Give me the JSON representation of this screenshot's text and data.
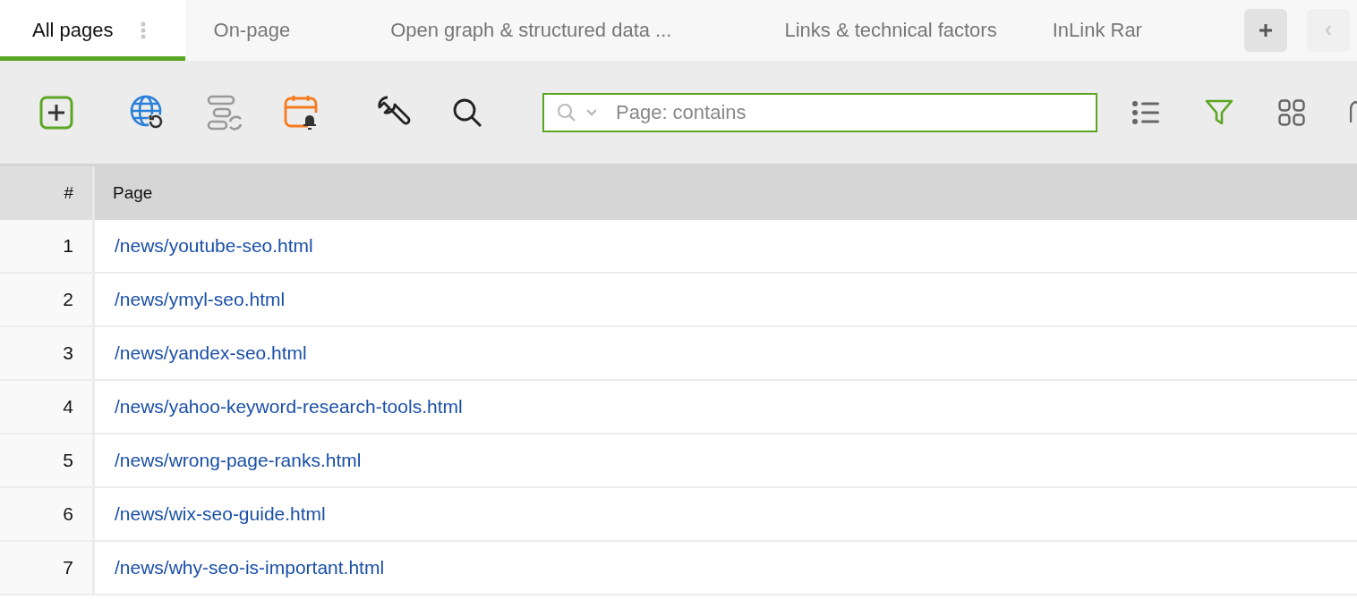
{
  "tabs": [
    {
      "label": "All pages",
      "selected": true
    },
    {
      "label": "On-page",
      "selected": false
    },
    {
      "label": "Open graph & structured data ...",
      "selected": false
    },
    {
      "label": "Links & technical factors",
      "selected": false
    },
    {
      "label": "InLink Rar",
      "selected": false
    }
  ],
  "search": {
    "placeholder": "Page: contains"
  },
  "table": {
    "columns": [
      "#",
      "Page"
    ],
    "rows": [
      {
        "num": "1",
        "page": "/news/youtube-seo.html"
      },
      {
        "num": "2",
        "page": "/news/ymyl-seo.html"
      },
      {
        "num": "3",
        "page": "/news/yandex-seo.html"
      },
      {
        "num": "4",
        "page": "/news/yahoo-keyword-research-tools.html"
      },
      {
        "num": "5",
        "page": "/news/wrong-page-ranks.html"
      },
      {
        "num": "6",
        "page": "/news/wix-seo-guide.html"
      },
      {
        "num": "7",
        "page": "/news/why-seo-is-important.html"
      }
    ]
  }
}
